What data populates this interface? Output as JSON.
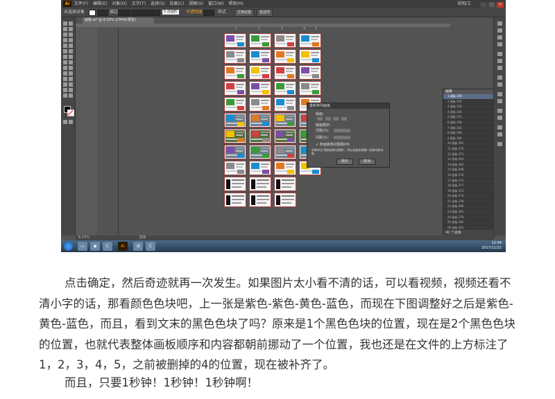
{
  "app": {
    "logo": "Ai",
    "menu": [
      "文件(F)",
      "编辑(E)",
      "对象(O)",
      "文字(T)",
      "选择(S)",
      "效果(C)",
      "视图(V)",
      "窗口(W)",
      "帮助(H)"
    ],
    "user": "说明/工"
  },
  "control_bar": {
    "selection_state": "未选择对象",
    "stroke_label": "描边",
    "stroke_value": "5 点圆形",
    "opacity_label": "不透明度",
    "style_label": "样式",
    "doc_setup_button": "文档设置",
    "prefs_button": "首选项"
  },
  "document_tab": "画板.ai* @ 8.33% (CMYK/预览)",
  "artboard_column_numbers": [
    "1",
    "2",
    "3",
    "4",
    "5"
  ],
  "dialog": {
    "title": "重新排列画板",
    "layout_label": "版面：",
    "order_label": "版面顺序：",
    "columns_label": "列数(O)：",
    "spacing_label": "间距(S)：",
    "move_art_label": "随画板移动图稿(M)",
    "note": "如果单击\"随画板移动图稿\"，将以画板和图稿一起移动和对象",
    "ok": "确定",
    "cancel": "取消"
  },
  "artboards_panel": {
    "tab": "画板",
    "rows": [
      {
        "n": "1",
        "name": "画板 258"
      },
      {
        "n": "2",
        "name": "画板 255"
      },
      {
        "n": "3",
        "name": "画板 256"
      },
      {
        "n": "4",
        "name": "画板 254"
      },
      {
        "n": "5",
        "name": "画板 253"
      },
      {
        "n": "6",
        "name": "画板 258"
      },
      {
        "n": "7",
        "name": "画板 263"
      },
      {
        "n": "8",
        "name": "画板 266"
      },
      {
        "n": "9",
        "name": "画板 260"
      },
      {
        "n": "10",
        "name": "画板 261"
      },
      {
        "n": "11",
        "name": "画板 270"
      },
      {
        "n": "12",
        "name": "画板 273"
      },
      {
        "n": "13",
        "name": "画板 264"
      },
      {
        "n": "14",
        "name": "画板 262"
      },
      {
        "n": "15",
        "name": "画板 268"
      },
      {
        "n": "16",
        "name": "画板 276"
      },
      {
        "n": "17",
        "name": "画板 275"
      },
      {
        "n": "18",
        "name": "画板 277"
      },
      {
        "n": "19",
        "name": "画板 272"
      },
      {
        "n": "20",
        "name": "画板 274"
      },
      {
        "n": "21",
        "name": "画板 278"
      },
      {
        "n": "22",
        "name": "画板 280"
      },
      {
        "n": "23",
        "name": "画板 281"
      },
      {
        "n": "24",
        "name": "画板 279"
      },
      {
        "n": "25",
        "name": "画板 282"
      },
      {
        "n": "26",
        "name": "画板 285"
      },
      {
        "n": "27",
        "name": "画板 286"
      }
    ],
    "footer": "40 个画板"
  },
  "status": {
    "zoom": "8.33%",
    "tool": "选择"
  },
  "taskbar": {
    "time": "12:04",
    "date": "2017/11/22"
  },
  "colors": {
    "purple": "#7b4fa8",
    "yellow": "#f2c200",
    "blue": "#1a8ccf",
    "green": "#3a9a3a",
    "black": "#111111"
  },
  "article": {
    "p1": "点击确定，然后奇迹就再一次发生。如果图片太小看不清的话，可以看视频，视频还看不清小字的话，那看颜色色块吧，上一张是紫色-紫色-黄色-蓝色，而现在下图调整好之后是紫色-黄色-蓝色，而且，看到文末的黑色色块了吗？原来是1个黑色色块的位置，现在是2个黑色色块的位置，也就代表整体画板顺序和内容都朝前挪动了一个位置，我也还是在文件的上方标注了1，2，3，4，5，之前被删掉的4的位置，现在被补齐了。",
    "p2": "而且，只要1秒钟！1秒钟！1秒钟啊！"
  }
}
